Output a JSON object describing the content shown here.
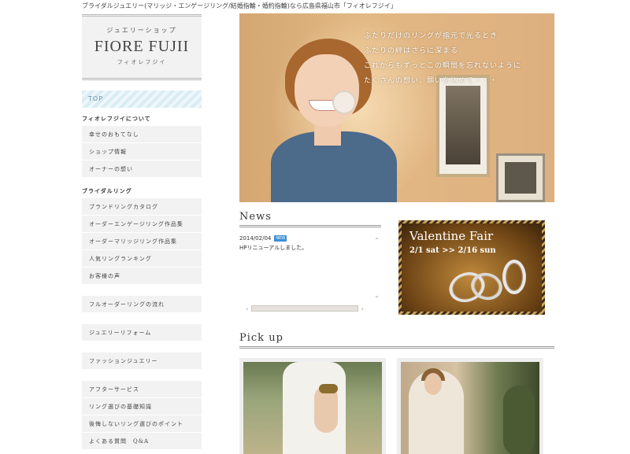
{
  "header": {
    "topline": "ブライダルジュエリー(マリッジ・エンゲージリング/結婚指輪・婚約指輪)なら広島県福山市「フィオレフジイ」"
  },
  "logo": {
    "jp": "ジュエリーショップ",
    "main": "FIORE FUJII",
    "kana": "フィオレフジイ"
  },
  "sidebar": {
    "top_label": "TOP",
    "section_about": {
      "heading": "フィオレフジイについて",
      "items": [
        "幸せのおもてなし",
        "ショップ情報",
        "オーナーの想い"
      ]
    },
    "section_bridal": {
      "heading": "ブライダルリング",
      "items": [
        "ブランドリングカタログ",
        "オーダーエンゲージリング作品集",
        "オーダーマリッジリング作品集",
        "人気リングランキング",
        "お客様の声"
      ]
    },
    "single_items": [
      "フルオーダーリングの流れ",
      "ジュエリーリフォーム",
      "ファッションジュエリー"
    ],
    "bottom_items": [
      "アフターサービス",
      "リング選びの基礎知識",
      "後悔しないリング選びのポイント",
      "よくある質問　Q&A"
    ]
  },
  "hero": {
    "lines": [
      "ふたりだけのリングが指元で光るとき",
      "ふたりの絆はさらに深まる",
      "これからもずっとこの瞬間を忘れないように",
      "たくさんの想い、願いを込めて・・・"
    ]
  },
  "news": {
    "title": "News",
    "items": [
      {
        "date": "2014/02/04",
        "badge": "NEW",
        "text": "HPリニューアルしました。"
      }
    ]
  },
  "banner": {
    "title": "Valentine Fair",
    "dates": "2/1 sat >> 2/16 sun"
  },
  "pickup": {
    "title": "Pick up"
  },
  "colors": {
    "top_button": "#d9ecf4",
    "menu_bg": "#f2f2f2",
    "badge": "#3b8fd9"
  }
}
